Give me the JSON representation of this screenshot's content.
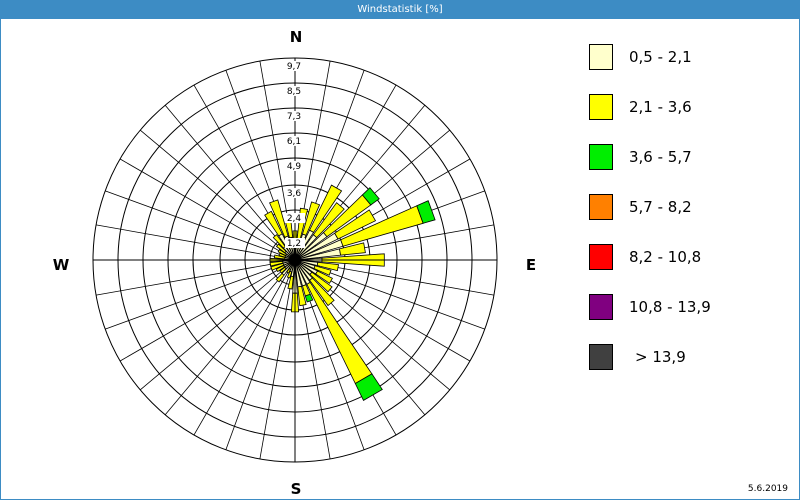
{
  "window": {
    "title": "Windstatistik [%]"
  },
  "date": "5.6.2019",
  "compass": {
    "north": "N",
    "east": "E",
    "south": "S",
    "west": "W"
  },
  "colors": {
    "titlebar": "#3d8cc4",
    "grid": "#000000",
    "bar_outline": "#000000"
  },
  "chart_data": {
    "type": "windrose",
    "title": "Windstatistik [%]",
    "unit": "%",
    "radial_max": 9.7,
    "ring_labels": [
      "1,2",
      "2,4",
      "3,6",
      "4,9",
      "6,1",
      "7,3",
      "8,5",
      "9,7"
    ],
    "ring_values": [
      1.2,
      2.4,
      3.6,
      4.9,
      6.1,
      7.3,
      8.5,
      9.7
    ],
    "sector_count": 36,
    "speed_classes": [
      {
        "label": "0,5 - 2,1",
        "color": "#ffffcc"
      },
      {
        "label": "2,1 - 3,6",
        "color": "#ffff00"
      },
      {
        "label": "3,6 - 5,7",
        "color": "#00ee00"
      },
      {
        "label": "5,7 - 8,2",
        "color": "#ff8000"
      },
      {
        "label": "8,2 - 10,8",
        "color": "#ff0000"
      },
      {
        "label": "10,8 - 13,9",
        "color": "#800080"
      },
      {
        "label": "> 13,9",
        "color": "#404040"
      }
    ],
    "sectors": [
      {
        "direction_deg": 0,
        "values": [
          0.6,
          0.8,
          0,
          0,
          0,
          0,
          0
        ]
      },
      {
        "direction_deg": 10,
        "values": [
          0.8,
          1.7,
          0,
          0,
          0,
          0,
          0
        ]
      },
      {
        "direction_deg": 20,
        "values": [
          1.3,
          1.6,
          0,
          0,
          0,
          0,
          0
        ]
      },
      {
        "direction_deg": 30,
        "values": [
          1.6,
          2.4,
          0,
          0,
          0,
          0,
          0
        ]
      },
      {
        "direction_deg": 40,
        "values": [
          1.5,
          1.9,
          0,
          0,
          0,
          0,
          0
        ]
      },
      {
        "direction_deg": 50,
        "values": [
          1.9,
          2.6,
          0.5,
          0,
          0,
          0,
          0
        ]
      },
      {
        "direction_deg": 60,
        "values": [
          2.3,
          2.0,
          0,
          0,
          0,
          0,
          0
        ]
      },
      {
        "direction_deg": 70,
        "values": [
          2.4,
          4.0,
          0.6,
          0,
          0,
          0,
          0
        ]
      },
      {
        "direction_deg": 80,
        "values": [
          2.2,
          1.2,
          0,
          0,
          0,
          0,
          0
        ]
      },
      {
        "direction_deg": 90,
        "values": [
          1.3,
          3.0,
          0,
          0,
          0,
          0,
          0
        ]
      },
      {
        "direction_deg": 100,
        "values": [
          1.1,
          1.0,
          0,
          0,
          0,
          0,
          0
        ]
      },
      {
        "direction_deg": 110,
        "values": [
          1.0,
          0.8,
          0,
          0,
          0,
          0,
          0
        ]
      },
      {
        "direction_deg": 120,
        "values": [
          1.2,
          0.8,
          0,
          0,
          0,
          0,
          0
        ]
      },
      {
        "direction_deg": 130,
        "values": [
          1.0,
          1.2,
          0,
          0,
          0,
          0,
          0
        ]
      },
      {
        "direction_deg": 140,
        "values": [
          1.2,
          1.5,
          0,
          0,
          0,
          0,
          0
        ]
      },
      {
        "direction_deg": 150,
        "values": [
          1.3,
          5.3,
          0.9,
          0,
          0,
          0,
          0
        ]
      },
      {
        "direction_deg": 160,
        "values": [
          1.3,
          0.5,
          0.3,
          0,
          0,
          0,
          0
        ]
      },
      {
        "direction_deg": 170,
        "values": [
          1.3,
          0.9,
          0,
          0,
          0,
          0,
          0
        ]
      },
      {
        "direction_deg": 180,
        "values": [
          1.6,
          0.9,
          0,
          0,
          0,
          0,
          0
        ]
      },
      {
        "direction_deg": 190,
        "values": [
          0.8,
          0.6,
          0,
          0,
          0,
          0,
          0
        ]
      },
      {
        "direction_deg": 200,
        "values": [
          0.6,
          0.3,
          0,
          0,
          0,
          0,
          0
        ]
      },
      {
        "direction_deg": 210,
        "values": [
          0.5,
          0.2,
          0,
          0,
          0,
          0,
          0
        ]
      },
      {
        "direction_deg": 220,
        "values": [
          0.9,
          0.4,
          0,
          0,
          0,
          0,
          0
        ]
      },
      {
        "direction_deg": 230,
        "values": [
          0.6,
          0.3,
          0,
          0,
          0,
          0,
          0
        ]
      },
      {
        "direction_deg": 240,
        "values": [
          0.6,
          0.4,
          0,
          0,
          0,
          0,
          0
        ]
      },
      {
        "direction_deg": 250,
        "values": [
          0.6,
          0.6,
          0,
          0,
          0,
          0,
          0
        ]
      },
      {
        "direction_deg": 260,
        "values": [
          0.6,
          0.6,
          0,
          0,
          0,
          0,
          0
        ]
      },
      {
        "direction_deg": 270,
        "values": [
          0.6,
          0.6,
          0,
          0,
          0,
          0,
          0
        ]
      },
      {
        "direction_deg": 280,
        "values": [
          0.5,
          0.5,
          0,
          0,
          0,
          0,
          0
        ]
      },
      {
        "direction_deg": 290,
        "values": [
          0.5,
          0.3,
          0,
          0,
          0,
          0,
          0
        ]
      },
      {
        "direction_deg": 300,
        "values": [
          0.5,
          0.4,
          0,
          0,
          0,
          0,
          0
        ]
      },
      {
        "direction_deg": 310,
        "values": [
          0.6,
          0.5,
          0,
          0,
          0,
          0,
          0
        ]
      },
      {
        "direction_deg": 320,
        "values": [
          0.8,
          0.7,
          0,
          0,
          0,
          0,
          0
        ]
      },
      {
        "direction_deg": 330,
        "values": [
          1.4,
          1.2,
          0,
          0,
          0,
          0,
          0
        ]
      },
      {
        "direction_deg": 340,
        "values": [
          1.2,
          1.8,
          0,
          0,
          0,
          0,
          0
        ]
      },
      {
        "direction_deg": 350,
        "values": [
          1.1,
          0.8,
          0,
          0,
          0,
          0,
          0
        ]
      }
    ]
  }
}
